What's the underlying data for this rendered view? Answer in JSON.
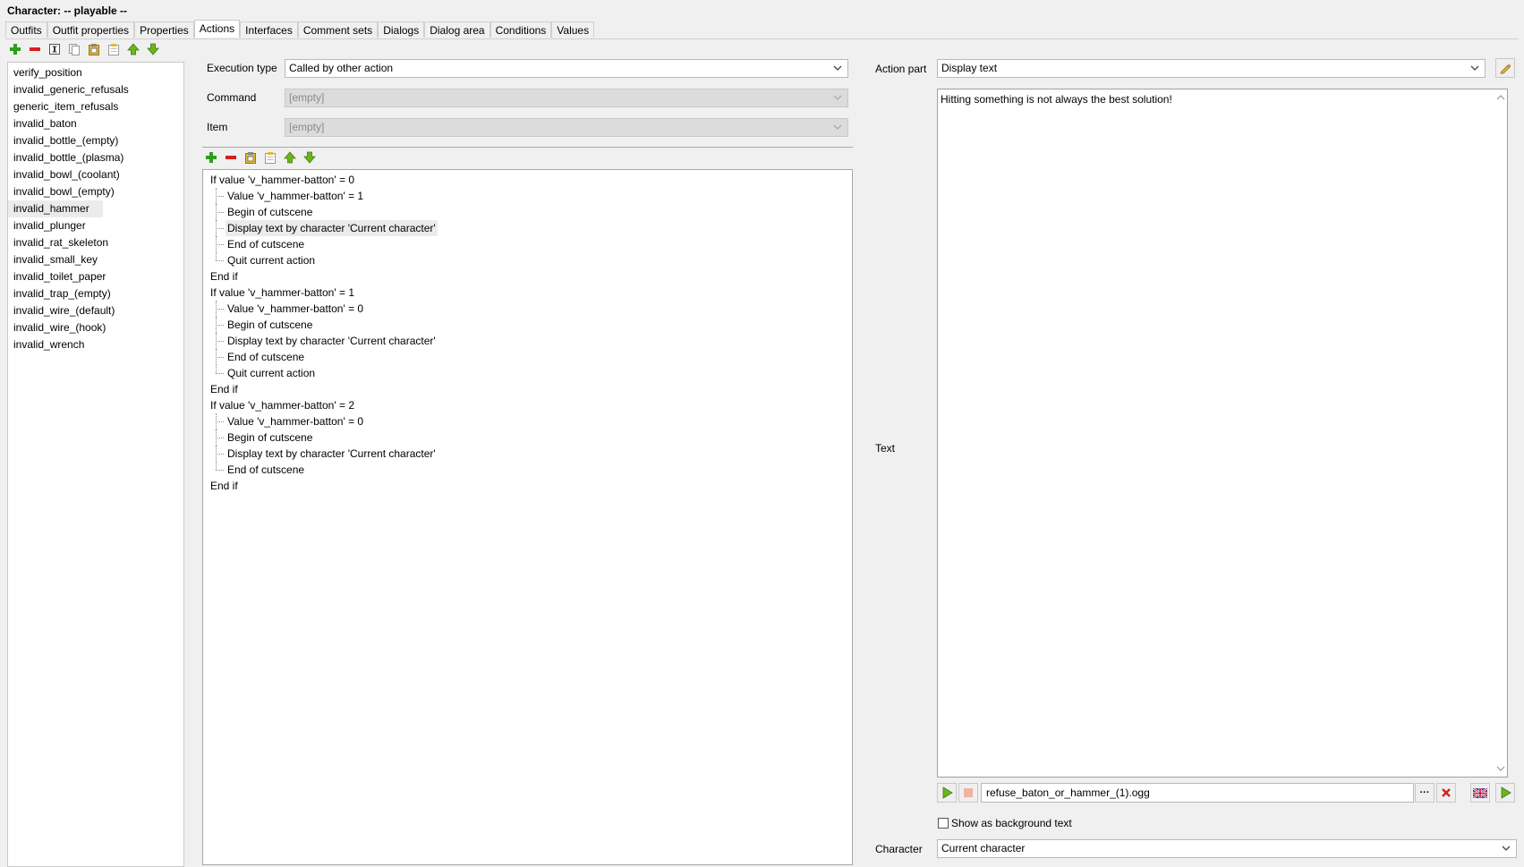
{
  "window": {
    "title": "Character: -- playable  --"
  },
  "tabs": [
    {
      "label": "Outfits"
    },
    {
      "label": "Outfit properties"
    },
    {
      "label": "Properties"
    },
    {
      "label": "Actions",
      "active": true
    },
    {
      "label": "Interfaces"
    },
    {
      "label": "Comment sets"
    },
    {
      "label": "Dialogs"
    },
    {
      "label": "Dialog area"
    },
    {
      "label": "Conditions"
    },
    {
      "label": "Values"
    }
  ],
  "actions_list": [
    "verify_position",
    "invalid_generic_refusals",
    "generic_item_refusals",
    "invalid_baton",
    "invalid_bottle_(empty)",
    "invalid_bottle_(plasma)",
    "invalid_bowl_(coolant)",
    "invalid_bowl_(empty)",
    "invalid_hammer",
    "invalid_plunger",
    "invalid_rat_skeleton",
    "invalid_small_key",
    "invalid_toilet_paper",
    "invalid_trap_(empty)",
    "invalid_wire_(default)",
    "invalid_wire_(hook)",
    "invalid_wrench"
  ],
  "selected_action": "invalid_hammer",
  "form": {
    "execution_type_label": "Execution type",
    "execution_type_value": "Called by other action",
    "command_label": "Command",
    "command_value": "[empty]",
    "item_label": "Item",
    "item_value": "[empty]"
  },
  "tree": [
    {
      "text": "If value 'v_hammer-batton' = 0",
      "level": 0
    },
    {
      "text": "Value 'v_hammer-batton' = 1",
      "level": 1
    },
    {
      "text": "Begin of cutscene",
      "level": 1
    },
    {
      "text": "Display text by character 'Current character'",
      "level": 1,
      "selected": true
    },
    {
      "text": "End of cutscene",
      "level": 1
    },
    {
      "text": "Quit current action",
      "level": 1,
      "last": true
    },
    {
      "text": "End if",
      "level": 0
    },
    {
      "text": "If value 'v_hammer-batton' = 1",
      "level": 0
    },
    {
      "text": "Value 'v_hammer-batton' = 0",
      "level": 1
    },
    {
      "text": "Begin of cutscene",
      "level": 1
    },
    {
      "text": "Display text by character 'Current character'",
      "level": 1
    },
    {
      "text": "End of cutscene",
      "level": 1
    },
    {
      "text": "Quit current action",
      "level": 1,
      "last": true
    },
    {
      "text": "End if",
      "level": 0
    },
    {
      "text": "If value 'v_hammer-batton' = 2",
      "level": 0
    },
    {
      "text": "Value 'v_hammer-batton' = 0",
      "level": 1
    },
    {
      "text": "Begin of cutscene",
      "level": 1
    },
    {
      "text": "Display text by character 'Current character'",
      "level": 1
    },
    {
      "text": "End of cutscene",
      "level": 1,
      "last": true
    },
    {
      "text": "End if",
      "level": 0
    }
  ],
  "right": {
    "action_part_label": "Action part",
    "action_part_value": "Display text",
    "text_label": "Text",
    "text_value": "Hitting something is not always the best solution!",
    "audio_file": "refuse_baton_or_hammer_(1).ogg",
    "browse_label": "···",
    "background_text_label": "Show as background text",
    "character_label": "Character",
    "character_value": "Current character"
  },
  "colors": {
    "add_green": "#2e9e1e",
    "remove_red": "#d42020",
    "arrow_green": "#6ab61c",
    "selection": "#ebebeb"
  }
}
